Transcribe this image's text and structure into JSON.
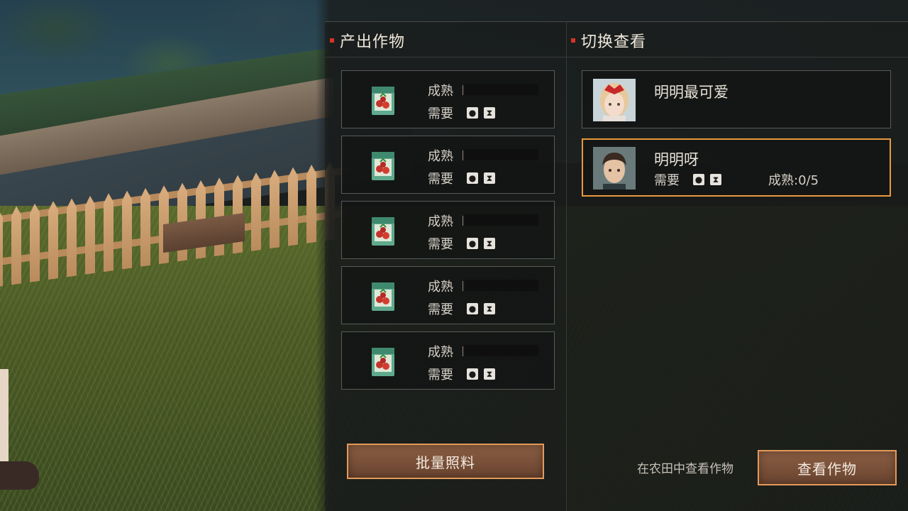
{
  "left_panel": {
    "title": "产出作物",
    "crops": [
      {
        "mature_label": "成熟",
        "need_label": "需要",
        "needs": [
          "water-drop-icon",
          "fertilizer-bag-icon"
        ]
      },
      {
        "mature_label": "成熟",
        "need_label": "需要",
        "needs": [
          "water-drop-icon",
          "fertilizer-bag-icon"
        ]
      },
      {
        "mature_label": "成熟",
        "need_label": "需要",
        "needs": [
          "water-drop-icon",
          "fertilizer-bag-icon"
        ]
      },
      {
        "mature_label": "成熟",
        "need_label": "需要",
        "needs": [
          "water-drop-icon",
          "fertilizer-bag-icon"
        ]
      },
      {
        "mature_label": "成熟",
        "need_label": "需要",
        "needs": [
          "water-drop-icon",
          "fertilizer-bag-icon"
        ]
      }
    ],
    "batch_button": "批量照料"
  },
  "right_panel": {
    "title": "切换查看",
    "players": [
      {
        "name": "明明最可爱",
        "selected": false
      },
      {
        "name": "明明呀",
        "need_label": "需要",
        "mature_text": "成熟:0/5",
        "selected": true
      }
    ],
    "hint": "在农田中查看作物",
    "view_button": "查看作物"
  },
  "colors": {
    "accent_border": "#e9993e",
    "button_fill": "#7a5038",
    "title_mark": "#d8332a",
    "text": "#e8e2d8"
  }
}
